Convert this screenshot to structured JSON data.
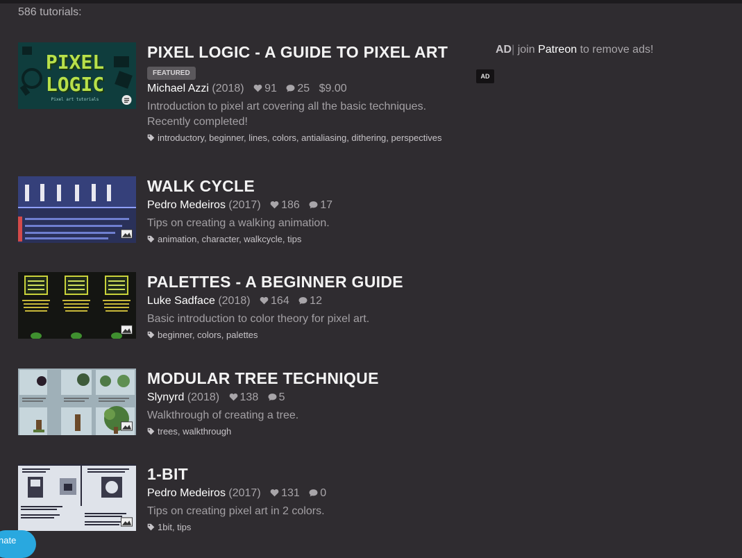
{
  "header": {
    "count_text": "586 tutorials:"
  },
  "sidebar_ad": {
    "ad_label": "AD",
    "separator": "|",
    "join_text": "join",
    "patreon_link": "Patreon",
    "remove_text": "to remove ads!",
    "badge": "AD"
  },
  "tutorials": [
    {
      "title": "PIXEL LOGIC - A GUIDE TO PIXEL ART",
      "featured": "FEATURED",
      "author": "Michael Azzi",
      "year": "(2018)",
      "likes": "91",
      "comments": "25",
      "price": "9.00",
      "description_line1": "Introduction to pixel art covering all the basic techniques.",
      "description_line2": "Recently completed!",
      "tags": "introductory, beginner, lines, colors, antialiasing, dithering, perspectives",
      "thumb_text_top": "PIXEL",
      "thumb_text_bottom": "LOGIC",
      "thumb_caption": "Pixel art tutorials"
    },
    {
      "title": "WALK CYCLE",
      "author": "Pedro Medeiros",
      "year": "(2017)",
      "likes": "186",
      "comments": "17",
      "description": "Tips on creating a walking animation.",
      "tags": "animation, character, walkcycle, tips"
    },
    {
      "title": "PALETTES - A BEGINNER GUIDE",
      "author": "Luke Sadface",
      "year": "(2018)",
      "likes": "164",
      "comments": "12",
      "description": "Basic introduction to color theory for pixel art.",
      "tags": "beginner, colors, palettes"
    },
    {
      "title": "MODULAR TREE TECHNIQUE",
      "author": "Slynyrd",
      "year": "(2018)",
      "likes": "138",
      "comments": "5",
      "description": "Walkthrough of creating a tree.",
      "tags": "trees, walkthrough"
    },
    {
      "title": "1-BIT",
      "author": "Pedro Medeiros",
      "year": "(2017)",
      "likes": "131",
      "comments": "0",
      "description": "Tips on creating pixel art in 2 colors.",
      "tags": "1bit, tips"
    }
  ],
  "icons": {
    "heart": "heart-icon",
    "comment": "comment-icon",
    "dollar": "dollar-icon",
    "tag": "tag-icon",
    "article": "article-icon",
    "image": "image-icon"
  },
  "colors": {
    "background": "#2f2c30",
    "title": "#f3f3f3",
    "author": "#ffffff",
    "muted": "#a8a5a9",
    "donate": "#29a8df"
  },
  "donate": {
    "label": "nate"
  }
}
